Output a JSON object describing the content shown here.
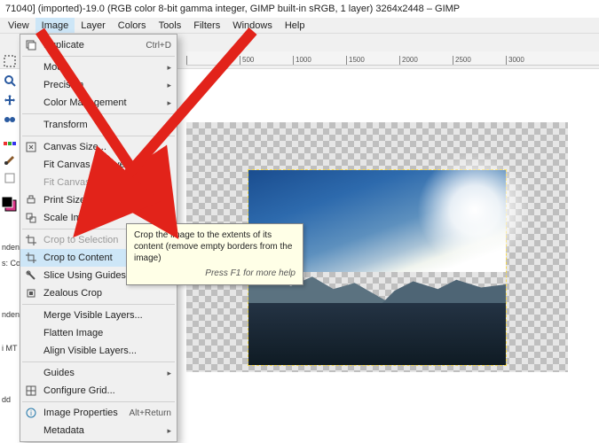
{
  "window_title": "71040] (imported)-19.0 (RGB color 8-bit gamma integer, GIMP built-in sRGB, 1 layer) 3264x2448 – GIMP",
  "menubar": [
    "View",
    "Image",
    "Layer",
    "Colors",
    "Tools",
    "Filters",
    "Windows",
    "Help"
  ],
  "open_menu_index": 1,
  "ruler_marks": [
    "",
    "500",
    "1000",
    "1500",
    "2000",
    "2500",
    "3000"
  ],
  "menu": {
    "items": [
      {
        "icon": "duplicate-icon",
        "label": "Duplicate",
        "accel": "Ctrl+D",
        "enabled": true
      },
      {
        "sep": true
      },
      {
        "label": "Mode",
        "submenu": true,
        "enabled": true
      },
      {
        "label": "Precision",
        "submenu": true,
        "enabled": true
      },
      {
        "label": "Color Management",
        "submenu": true,
        "enabled": true
      },
      {
        "sep": true
      },
      {
        "label": "Transform",
        "submenu": true,
        "enabled": true
      },
      {
        "sep": true
      },
      {
        "icon": "canvas-size-icon",
        "label": "Canvas Size...",
        "enabled": true
      },
      {
        "label": "Fit Canvas to Layers",
        "enabled": true
      },
      {
        "label": "Fit Canvas to Selection",
        "enabled": false
      },
      {
        "icon": "print-size-icon",
        "label": "Print Size...",
        "enabled": true
      },
      {
        "icon": "scale-image-icon",
        "label": "Scale Image...",
        "enabled": true
      },
      {
        "sep": true
      },
      {
        "icon": "crop-icon",
        "label": "Crop to Selection",
        "enabled": false
      },
      {
        "icon": "crop-icon",
        "label": "Crop to Content",
        "enabled": true,
        "highlight": true
      },
      {
        "icon": "slice-icon",
        "label": "Slice Using Guides",
        "enabled": true
      },
      {
        "icon": "zealous-icon",
        "label": "Zealous Crop",
        "enabled": true
      },
      {
        "sep": true
      },
      {
        "label": "Merge Visible Layers...",
        "enabled": true
      },
      {
        "label": "Flatten Image",
        "enabled": true
      },
      {
        "label": "Align Visible Layers...",
        "enabled": true
      },
      {
        "sep": true
      },
      {
        "label": "Guides",
        "submenu": true,
        "enabled": true
      },
      {
        "icon": "grid-icon",
        "label": "Configure Grid...",
        "enabled": true
      },
      {
        "sep": true
      },
      {
        "icon": "info-icon",
        "label": "Image Properties",
        "accel": "Alt+Return",
        "enabled": true
      },
      {
        "label": "Metadata",
        "submenu": true,
        "enabled": true
      }
    ]
  },
  "tooltip": {
    "body": "Crop the image to the extents of its content (remove empty borders from the image)",
    "help": "Press F1 for more help"
  },
  "left_panel_rows": [
    "ndensed",
    "s: Cond",
    "ndensed",
    "i MT Bold,",
    "dd"
  ]
}
